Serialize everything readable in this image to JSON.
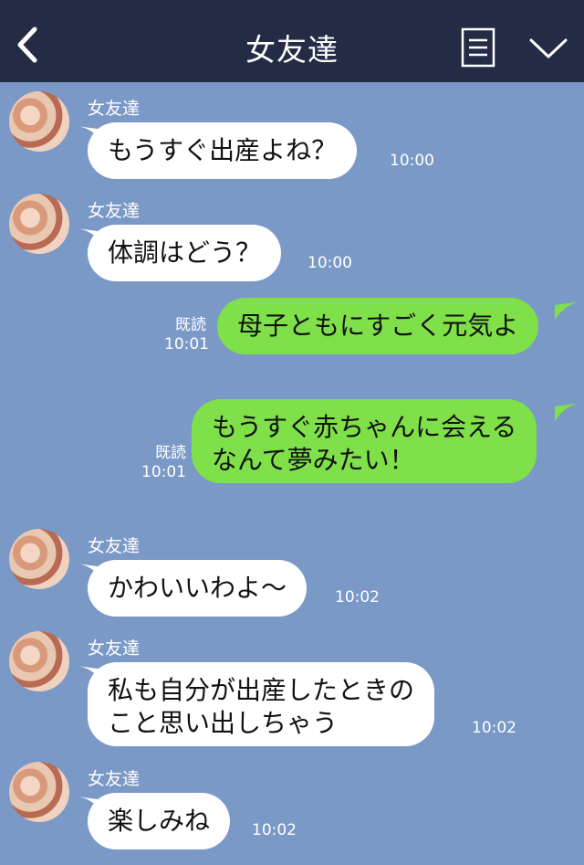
{
  "header": {
    "title": "女友達",
    "back_icon": "chevron-left-icon",
    "menu_icon": "notes-icon",
    "dropdown_icon": "chevron-down-icon"
  },
  "colors": {
    "header_bg": "#232c44",
    "chat_bg": "#7b99c6",
    "incoming_bubble": "#ffffff",
    "outgoing_bubble": "#7fe04a"
  },
  "messages": [
    {
      "direction": "in",
      "sender": "女友達",
      "lines": [
        "もうすぐ出産よね？"
      ],
      "time": "10:00"
    },
    {
      "direction": "in",
      "sender": "女友達",
      "lines": [
        "体調はどう？"
      ],
      "time": "10:00"
    },
    {
      "direction": "out",
      "read": "既読",
      "lines": [
        "母子ともにすごく元気よ"
      ],
      "time": "10:01"
    },
    {
      "direction": "out",
      "read": "既読",
      "lines": [
        "もうすぐ赤ちゃんに会える",
        "なんて夢みたい！"
      ],
      "time": "10:01"
    },
    {
      "direction": "in",
      "sender": "女友達",
      "lines": [
        "かわいいわよ〜"
      ],
      "time": "10:02"
    },
    {
      "direction": "in",
      "sender": "女友達",
      "lines": [
        "私も自分が出産したときの",
        "こと思い出しちゃう"
      ],
      "time": "10:02"
    },
    {
      "direction": "in",
      "sender": "女友達",
      "lines": [
        "楽しみね"
      ],
      "time": "10:02"
    }
  ]
}
